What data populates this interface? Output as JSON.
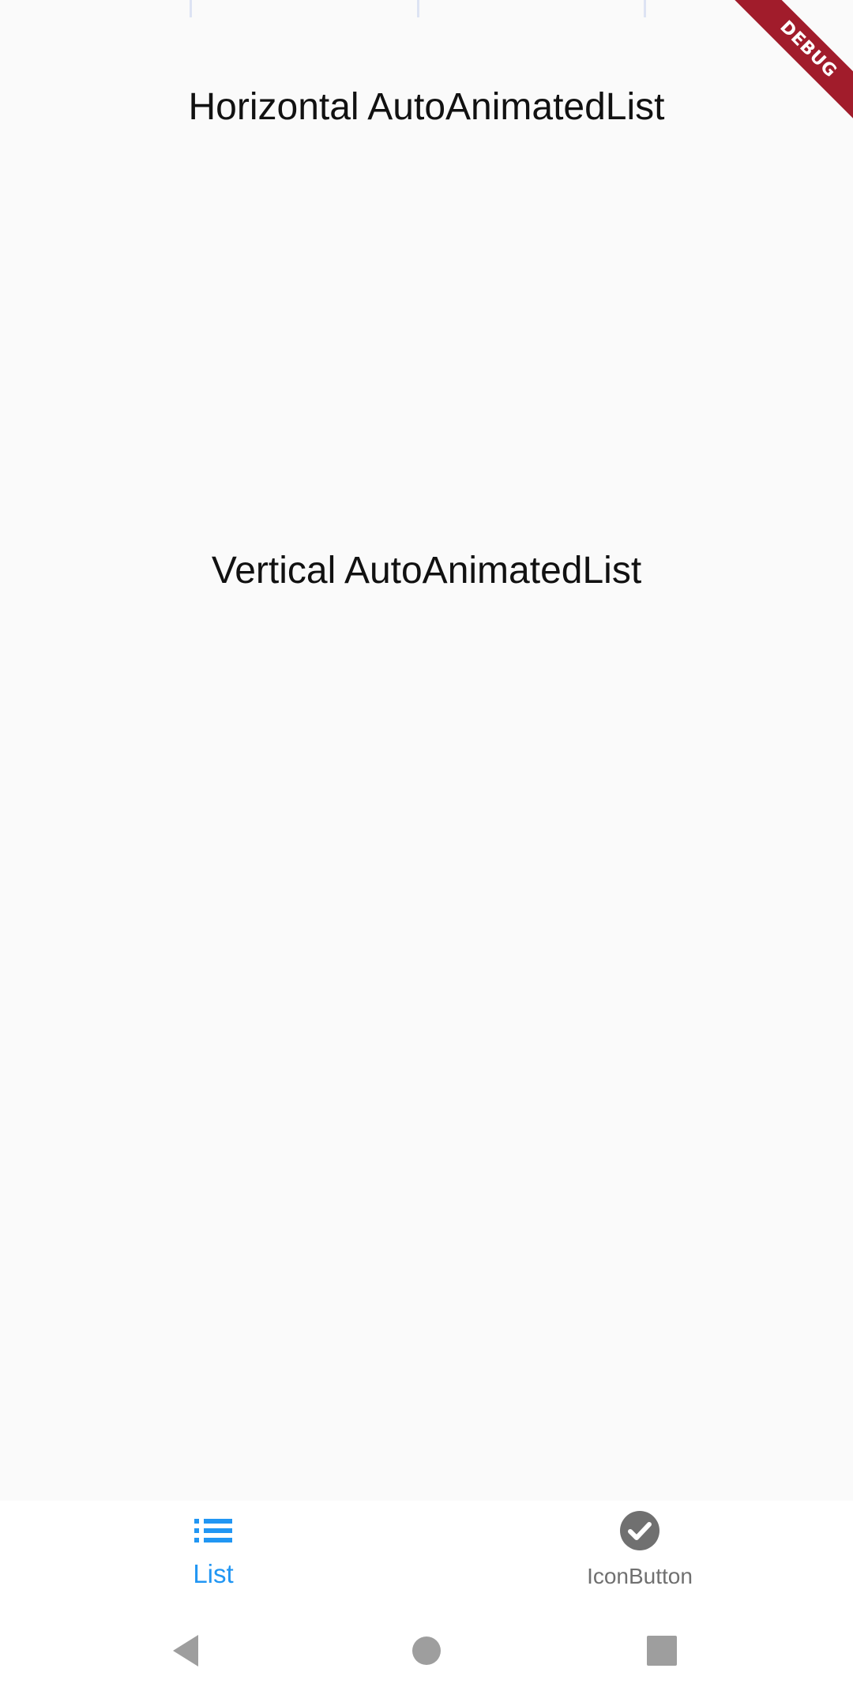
{
  "debug_banner": {
    "label": "DEBUG",
    "color": "#a11c2b"
  },
  "sections": {
    "horizontal_title": "Horizontal AutoAnimatedList",
    "vertical_title": "Vertical AutoAnimatedList"
  },
  "bottom_nav": {
    "active_color": "#2196f3",
    "inactive_color": "#707070",
    "items": [
      {
        "label": "List",
        "icon": "list-icon",
        "active": true
      },
      {
        "label": "IconButton",
        "icon": "check-circle-icon",
        "active": false
      }
    ]
  },
  "system_nav": {
    "buttons": [
      "back-icon",
      "home-icon",
      "recents-icon"
    ]
  }
}
